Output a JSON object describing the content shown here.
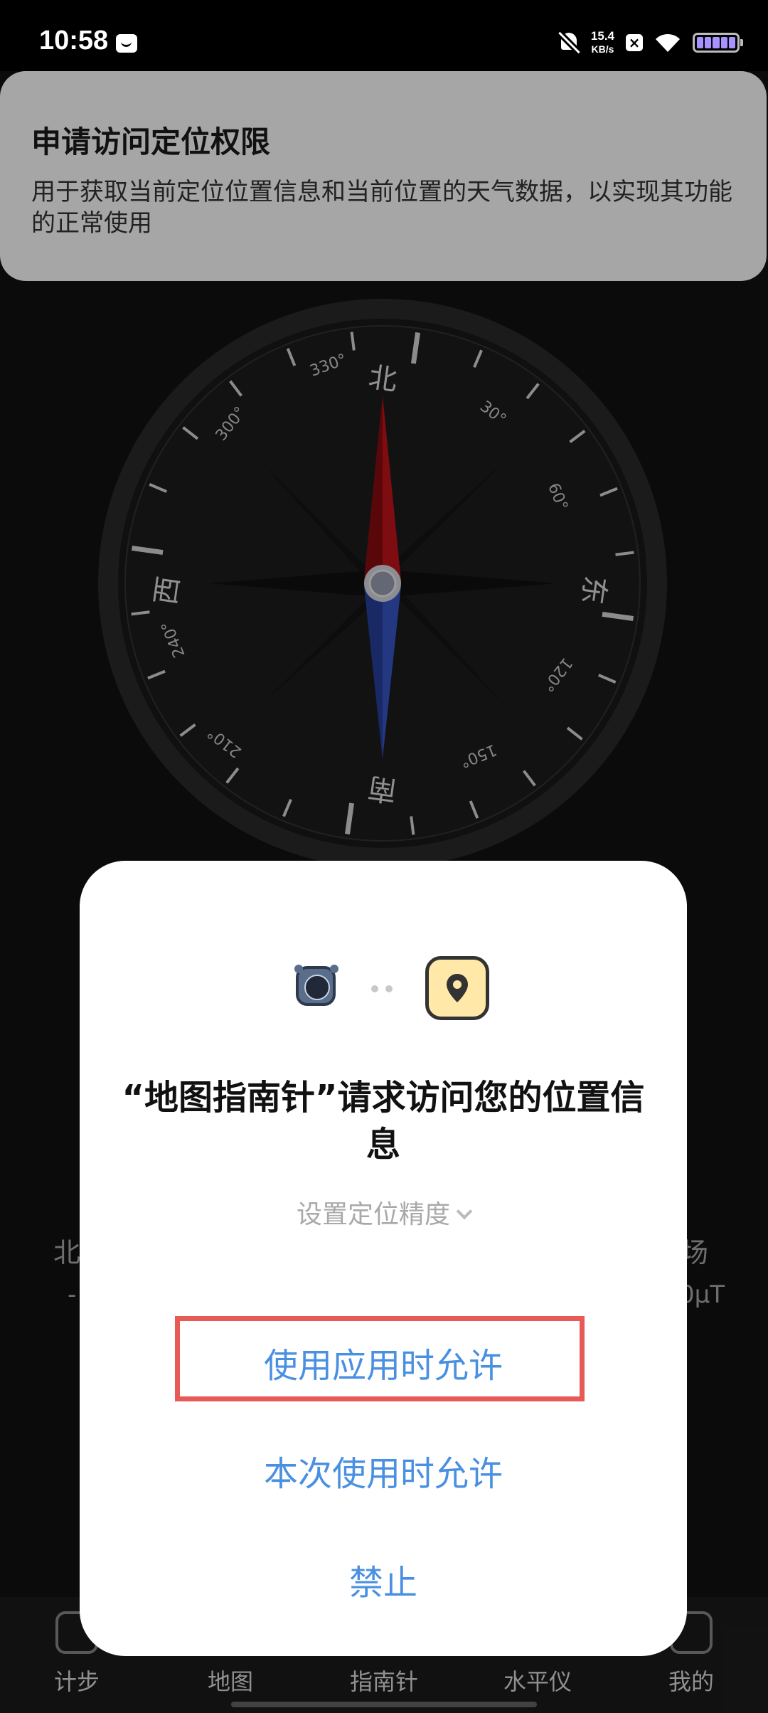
{
  "status_bar": {
    "time": "10:58",
    "net_speed_value": "15.4",
    "net_speed_unit": "KB/s",
    "x_label": "×"
  },
  "compass": {
    "north": "北",
    "east": "东",
    "south": "南",
    "west": "西",
    "deg_30": "30°",
    "deg_60": "60°",
    "deg_120": "120°",
    "deg_150": "150°",
    "deg_210": "210°",
    "deg_240": "240°",
    "deg_300": "300°",
    "deg_330": "330°"
  },
  "background_readings": {
    "left_label": "北",
    "left_value": "-",
    "right_label": "场",
    "right_value": "0μT"
  },
  "permission_banner": {
    "title": "申请访问定位权限",
    "description": "用于获取当前定位位置信息和当前位置的天气数据，以实现其功能的正常使用"
  },
  "dialog": {
    "title": "“地图指南针”请求访问您的位置信息",
    "precision_label": "设置定位精度",
    "allow_while_using": "使用应用时允许",
    "allow_this_time": "本次使用时允许",
    "deny": "禁止"
  },
  "bottom_nav": {
    "items": [
      {
        "label": "计步"
      },
      {
        "label": "地图"
      },
      {
        "label": "指南针"
      },
      {
        "label": "水平仪"
      },
      {
        "label": "我的"
      }
    ]
  },
  "colors": {
    "accent_blue": "#4a90e2",
    "highlight_red": "#e85a55",
    "needle_north": "#c0141a",
    "needle_south": "#3856c8"
  }
}
